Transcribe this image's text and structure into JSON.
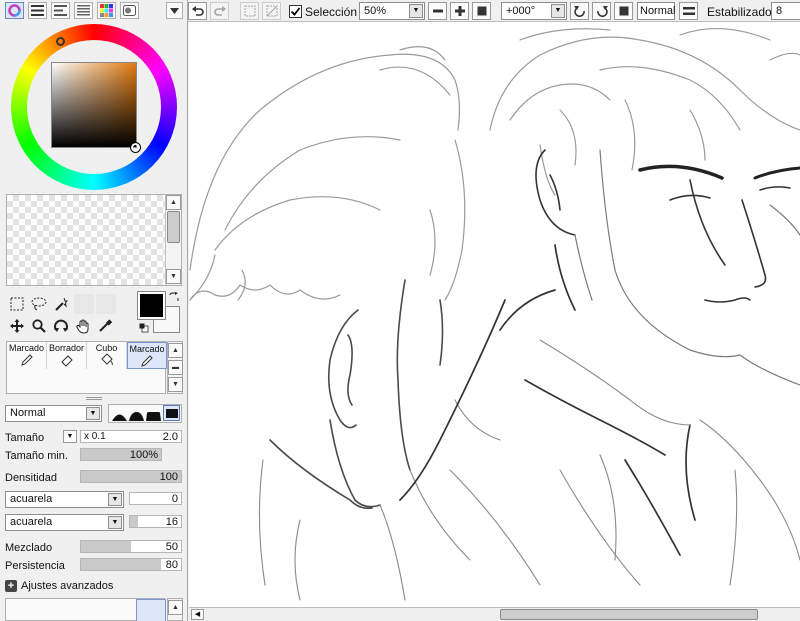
{
  "toolbar_left": {
    "icons": [
      "color-wheel-icon",
      "rgb-sliders-icon",
      "hsv-sliders-icon",
      "color-table-icon",
      "color-palette-icon",
      "user-swatch-icon"
    ]
  },
  "brushes": {
    "items": [
      {
        "label": "Marcado",
        "icon": "pencil-icon"
      },
      {
        "label": "Borrador",
        "icon": "eraser-icon"
      },
      {
        "label": "Cubo",
        "icon": "bucket-icon"
      },
      {
        "label": "Marcado",
        "icon": "pencil-icon"
      }
    ],
    "active_index": 3
  },
  "blend_mode": "Normal",
  "settings": {
    "tamano_label": "Tamaño",
    "tamano_multiplier": "x 0.1",
    "tamano_value": "2.0",
    "tamano_min_label": "Tamaño min.",
    "tamano_min_value": "100%",
    "densidad_label": "Densitidad",
    "densidad_value": "100",
    "texture1_name": "acuarela",
    "texture1_value": "0",
    "texture2_name": "acuarela",
    "texture2_value": "16",
    "mezclado_label": "Mezclado",
    "mezclado_value": "50",
    "persistencia_label": "Persistencia",
    "persistencia_value": "80",
    "advanced_label": "Ajustes avanzados"
  },
  "settings_levels": {
    "tamano_min": 1.0,
    "densidad": 1.0,
    "mezclado": 0.5,
    "persistencia": 0.8
  },
  "colors": {
    "foreground": "#000000",
    "background": "#f8f8f8",
    "hue_accent": "#e07a10",
    "selection_highlight": "#dde6fb"
  },
  "topbar": {
    "seleccion_label": "Selección",
    "seleccion_checked": true,
    "zoom_value": "50%",
    "rotation_value": "+000°",
    "blend_mode_label": "Normal",
    "stabilizer_label": "Estabilizador",
    "stabilizer_value": "8"
  }
}
